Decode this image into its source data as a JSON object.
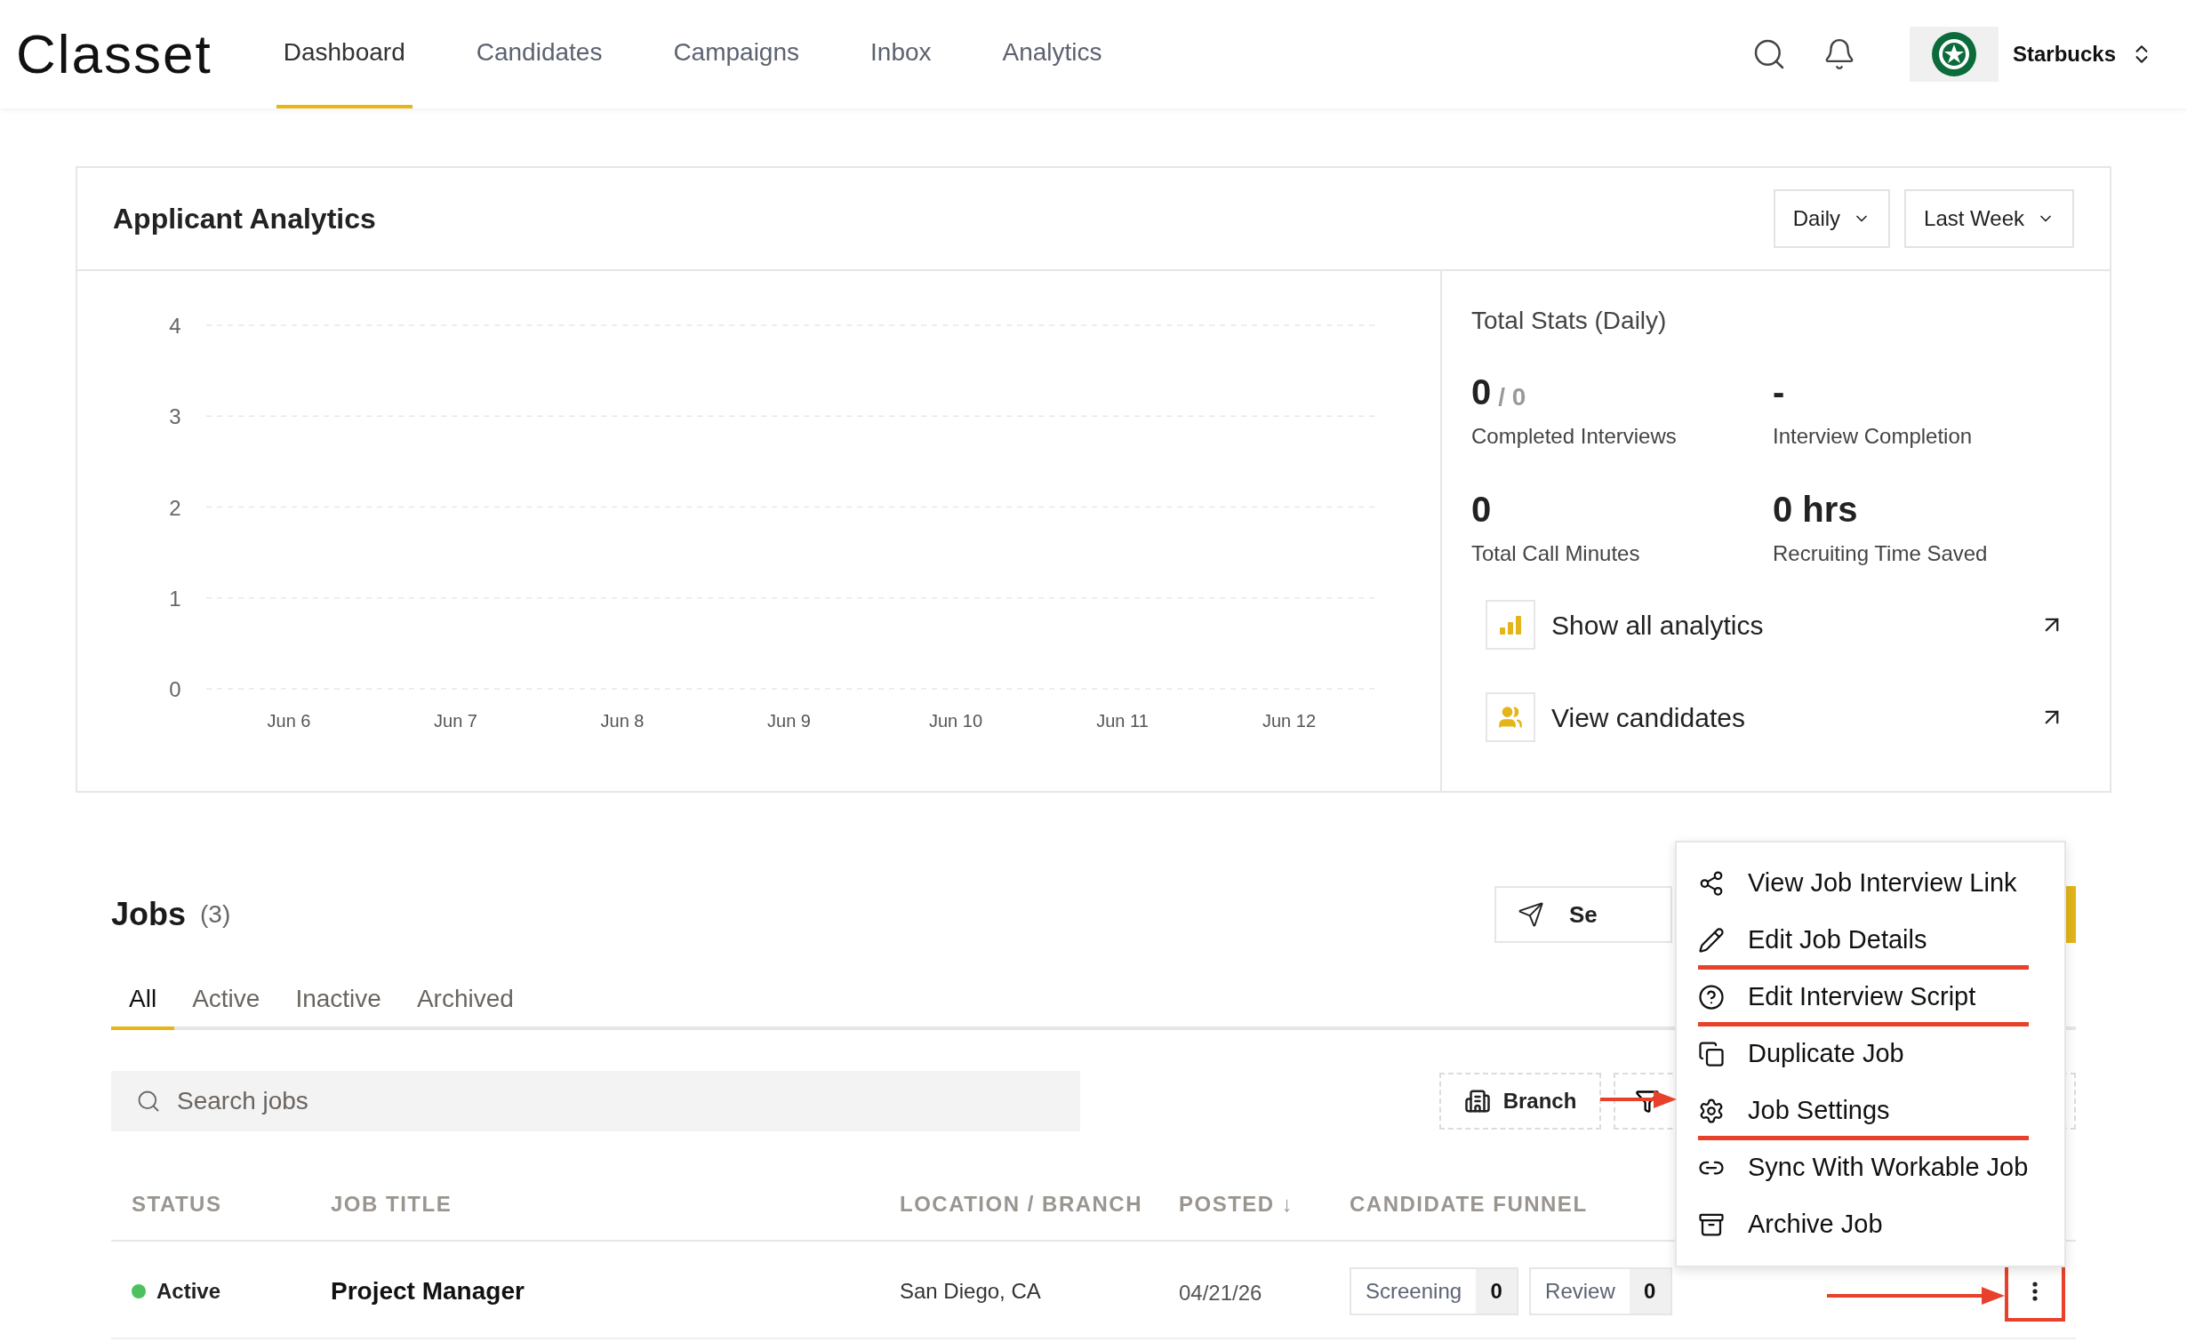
{
  "header": {
    "logo": "Classet",
    "nav": [
      {
        "label": "Dashboard",
        "selected": true
      },
      {
        "label": "Candidates",
        "selected": false
      },
      {
        "label": "Campaigns",
        "selected": false
      },
      {
        "label": "Inbox",
        "selected": false
      },
      {
        "label": "Analytics",
        "selected": false
      }
    ],
    "account": {
      "name": "Starbucks"
    }
  },
  "analytics": {
    "title": "Applicant Analytics",
    "filters": [
      "Daily",
      "Last Week"
    ],
    "chart_data": {
      "type": "line",
      "categories": [
        "Jun 6",
        "Jun 7",
        "Jun 8",
        "Jun 9",
        "Jun 10",
        "Jun 11",
        "Jun 12"
      ],
      "ylim": [
        0,
        4
      ],
      "yticks": [
        0,
        1,
        2,
        3,
        4
      ],
      "grid": true
    },
    "stats": {
      "title": "Total Stats (Daily)",
      "items": [
        {
          "value": "0",
          "secondary": "/ 0",
          "label": "Completed Interviews"
        },
        {
          "value": "-",
          "label": "Interview Completion"
        },
        {
          "value": "0",
          "label": "Total Call Minutes"
        },
        {
          "value": "0 hrs",
          "label": "Recruiting Time Saved"
        }
      ]
    },
    "links": [
      {
        "label": "Show all analytics",
        "kind": "chart"
      },
      {
        "label": "View candidates",
        "kind": "people"
      }
    ]
  },
  "jobs": {
    "title": "Jobs",
    "count": "(3)",
    "send_button": "Se",
    "tabs": [
      {
        "label": "All",
        "selected": true
      },
      {
        "label": "Active",
        "selected": false
      },
      {
        "label": "Inactive",
        "selected": false
      },
      {
        "label": "Archived",
        "selected": false
      }
    ],
    "search": {
      "placeholder": "Search jobs"
    },
    "filters": [
      {
        "label": "Branch",
        "kind": "branch"
      },
      {
        "kind": "covered"
      }
    ],
    "columns": [
      "STATUS",
      "JOB TITLE",
      "LOCATION / BRANCH",
      "POSTED ↓",
      "CANDIDATE FUNNEL"
    ],
    "rows": [
      {
        "status": "Active",
        "color": "#4cc15f",
        "title": "Project Manager",
        "location": "San Diego, CA",
        "posted": "04/21/26",
        "funnel": [
          {
            "stage": "Screening",
            "count": "0"
          },
          {
            "stage": "Review",
            "count": "0"
          }
        ]
      }
    ]
  },
  "menu": {
    "items": [
      {
        "label": "View Job Interview Link",
        "kind": "share",
        "underlined": false
      },
      {
        "label": "Edit Job Details",
        "kind": "edit",
        "underlined": true
      },
      {
        "label": "Edit Interview Script",
        "kind": "help",
        "underlined": true
      },
      {
        "label": "Duplicate Job",
        "kind": "copy",
        "underlined": false
      },
      {
        "label": "Job Settings",
        "kind": "settings",
        "underlined": true
      },
      {
        "label": "Sync With Workable Job",
        "kind": "link",
        "underlined": false
      },
      {
        "label": "Archive Job",
        "kind": "archive",
        "underlined": false
      }
    ]
  }
}
